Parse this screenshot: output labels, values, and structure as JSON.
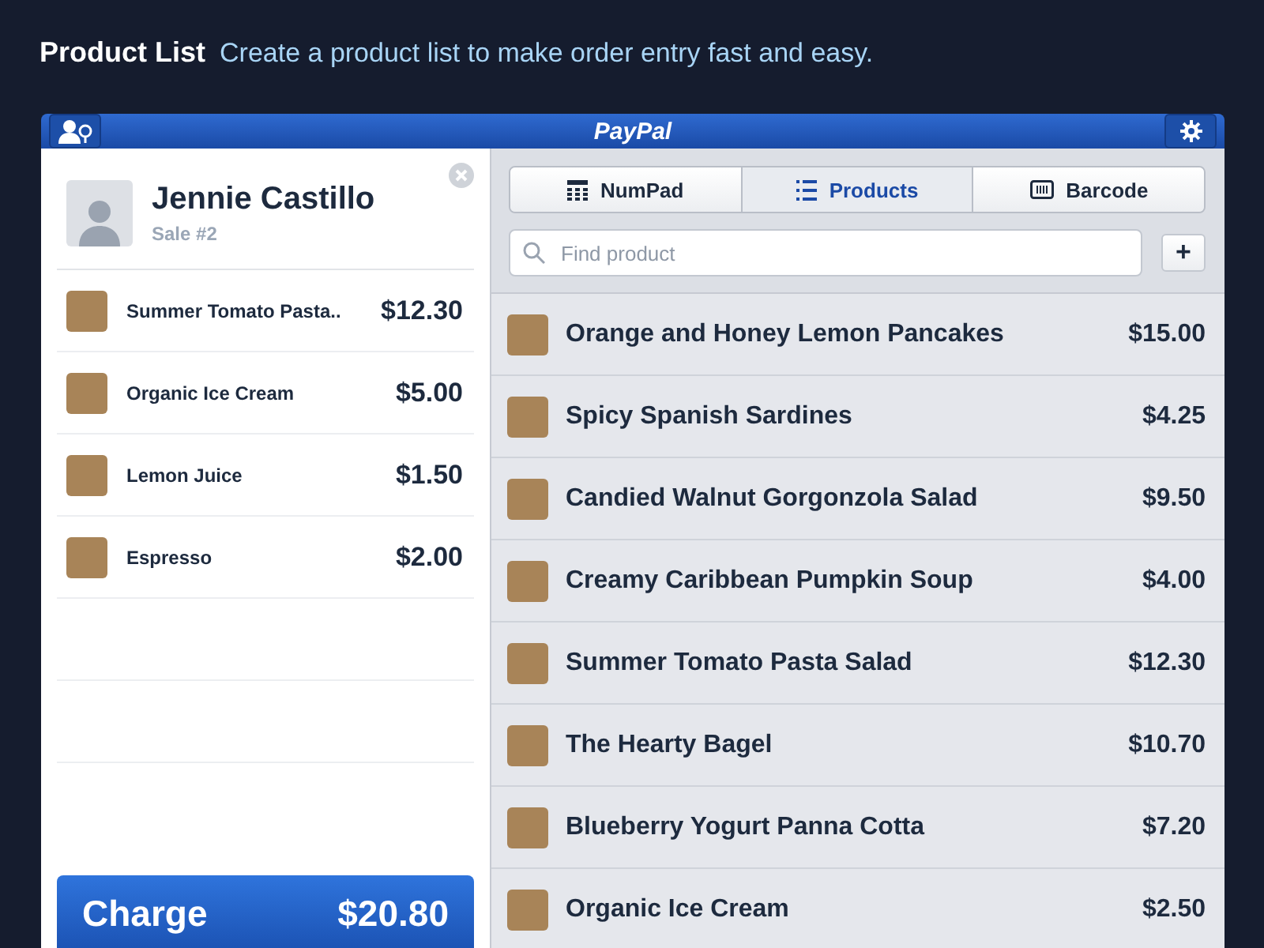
{
  "header": {
    "title": "Product List",
    "subtitle": "Create a product list to make order entry fast and easy."
  },
  "window": {
    "title": "PayPal"
  },
  "customer": {
    "name": "Jennie Castillo",
    "sale": "Sale #2"
  },
  "cart": [
    {
      "name": "Summer Tomato Pasta..",
      "price": "$12.30"
    },
    {
      "name": "Organic Ice Cream",
      "price": "$5.00"
    },
    {
      "name": "Lemon Juice",
      "price": "$1.50"
    },
    {
      "name": "Espresso",
      "price": "$2.00"
    }
  ],
  "charge": {
    "label": "Charge",
    "total": "$20.80"
  },
  "tabs": [
    {
      "label": "NumPad",
      "kind": "numpad",
      "selected": false
    },
    {
      "label": "Products",
      "kind": "list",
      "selected": true
    },
    {
      "label": "Barcode",
      "kind": "barcode",
      "selected": false
    }
  ],
  "search": {
    "placeholder": "Find product"
  },
  "add_button": "+",
  "products": [
    {
      "name": "Orange and Honey Lemon Pancakes",
      "price": "$15.00"
    },
    {
      "name": "Spicy Spanish Sardines",
      "price": "$4.25"
    },
    {
      "name": "Candied Walnut Gorgonzola Salad",
      "price": "$9.50"
    },
    {
      "name": "Creamy Caribbean Pumpkin Soup",
      "price": "$4.00"
    },
    {
      "name": "Summer Tomato Pasta Salad",
      "price": "$12.30"
    },
    {
      "name": "The Hearty Bagel",
      "price": "$10.70"
    },
    {
      "name": "Blueberry Yogurt Panna Cotta",
      "price": "$7.20"
    },
    {
      "name": "Organic Ice Cream",
      "price": "$2.50"
    }
  ]
}
